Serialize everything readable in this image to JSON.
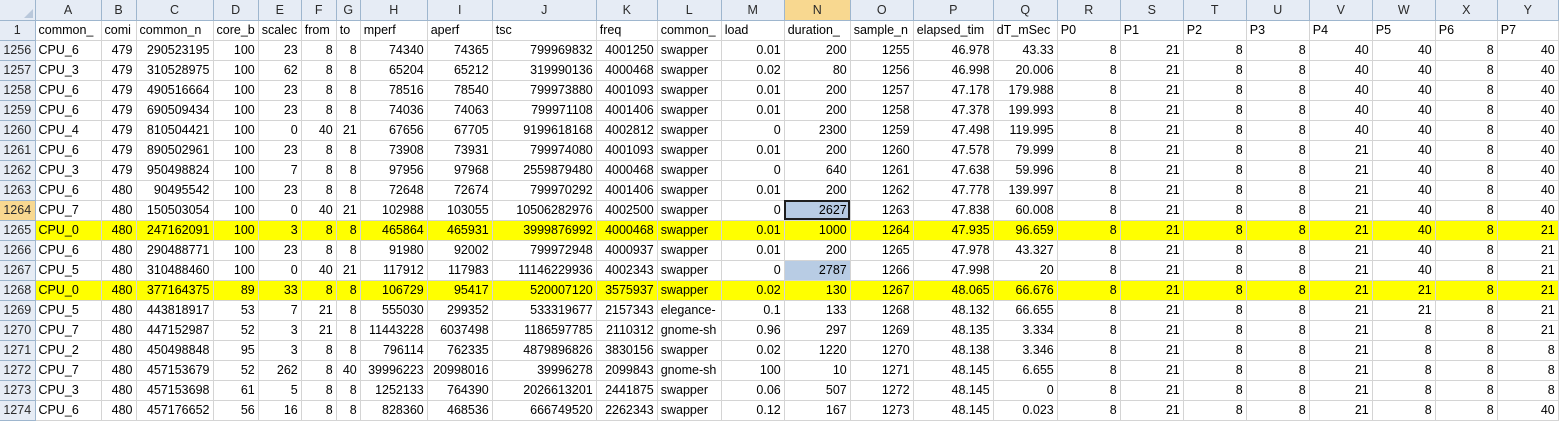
{
  "columns": [
    "A",
    "B",
    "C",
    "D",
    "E",
    "F",
    "G",
    "H",
    "I",
    "J",
    "K",
    "L",
    "M",
    "N",
    "O",
    "P",
    "Q",
    "R",
    "S",
    "T",
    "U",
    "V",
    "W",
    "X",
    "Y"
  ],
  "header_row": {
    "number": "1",
    "cells": [
      "common_",
      "comi",
      "common_n",
      "core_b",
      "scalec",
      "from",
      "to",
      "mperf",
      "aperf",
      "tsc",
      "freq",
      "common_",
      "load",
      "duration_",
      "sample_n",
      "elapsed_tim",
      "dT_mSec",
      "P0",
      "P1",
      "P2",
      "P3",
      "P4",
      "P5",
      "P6",
      "P7"
    ]
  },
  "rows": [
    {
      "n": "1256",
      "c": [
        "CPU_6",
        "479",
        "290523195",
        "100",
        "23",
        "8",
        "8",
        "74340",
        "74365",
        "799969832",
        "4001250",
        "swapper",
        "0.01",
        "200",
        "1255",
        "46.978",
        "43.33",
        "8",
        "21",
        "8",
        "8",
        "40",
        "40",
        "8",
        "40"
      ]
    },
    {
      "n": "1257",
      "c": [
        "CPU_3",
        "479",
        "310528975",
        "100",
        "62",
        "8",
        "8",
        "65204",
        "65212",
        "319990136",
        "4000468",
        "swapper",
        "0.02",
        "80",
        "1256",
        "46.998",
        "20.006",
        "8",
        "21",
        "8",
        "8",
        "40",
        "40",
        "8",
        "40"
      ]
    },
    {
      "n": "1258",
      "c": [
        "CPU_6",
        "479",
        "490516664",
        "100",
        "23",
        "8",
        "8",
        "78516",
        "78540",
        "799973880",
        "4001093",
        "swapper",
        "0.01",
        "200",
        "1257",
        "47.178",
        "179.988",
        "8",
        "21",
        "8",
        "8",
        "40",
        "40",
        "8",
        "40"
      ]
    },
    {
      "n": "1259",
      "c": [
        "CPU_6",
        "479",
        "690509434",
        "100",
        "23",
        "8",
        "8",
        "74036",
        "74063",
        "799971108",
        "4001406",
        "swapper",
        "0.01",
        "200",
        "1258",
        "47.378",
        "199.993",
        "8",
        "21",
        "8",
        "8",
        "40",
        "40",
        "8",
        "40"
      ]
    },
    {
      "n": "1260",
      "c": [
        "CPU_4",
        "479",
        "810504421",
        "100",
        "0",
        "40",
        "21",
        "67656",
        "67705",
        "9199618168",
        "4002812",
        "swapper",
        "0",
        "2300",
        "1259",
        "47.498",
        "119.995",
        "8",
        "21",
        "8",
        "8",
        "40",
        "40",
        "8",
        "40"
      ]
    },
    {
      "n": "1261",
      "c": [
        "CPU_6",
        "479",
        "890502961",
        "100",
        "23",
        "8",
        "8",
        "73908",
        "73931",
        "799974080",
        "4001093",
        "swapper",
        "0.01",
        "200",
        "1260",
        "47.578",
        "79.999",
        "8",
        "21",
        "8",
        "8",
        "21",
        "40",
        "8",
        "40"
      ]
    },
    {
      "n": "1262",
      "c": [
        "CPU_3",
        "479",
        "950498824",
        "100",
        "7",
        "8",
        "8",
        "97956",
        "97968",
        "2559879480",
        "4000468",
        "swapper",
        "0",
        "640",
        "1261",
        "47.638",
        "59.996",
        "8",
        "21",
        "8",
        "8",
        "21",
        "40",
        "8",
        "40"
      ]
    },
    {
      "n": "1263",
      "c": [
        "CPU_6",
        "480",
        "90495542",
        "100",
        "23",
        "8",
        "8",
        "72648",
        "72674",
        "799970292",
        "4001406",
        "swapper",
        "0.01",
        "200",
        "1262",
        "47.778",
        "139.997",
        "8",
        "21",
        "8",
        "8",
        "21",
        "40",
        "8",
        "40"
      ]
    },
    {
      "n": "1264",
      "c": [
        "CPU_7",
        "480",
        "150503054",
        "100",
        "0",
        "40",
        "21",
        "102988",
        "103055",
        "10506282976",
        "4002500",
        "swapper",
        "0",
        "2627",
        "1263",
        "47.838",
        "60.008",
        "8",
        "21",
        "8",
        "8",
        "21",
        "40",
        "8",
        "40"
      ]
    },
    {
      "n": "1265",
      "c": [
        "CPU_0",
        "480",
        "247162091",
        "100",
        "3",
        "8",
        "8",
        "465864",
        "465931",
        "3999876992",
        "4000468",
        "swapper",
        "0.01",
        "1000",
        "1264",
        "47.935",
        "96.659",
        "8",
        "21",
        "8",
        "8",
        "21",
        "40",
        "8",
        "21"
      ]
    },
    {
      "n": "1266",
      "c": [
        "CPU_6",
        "480",
        "290488771",
        "100",
        "23",
        "8",
        "8",
        "91980",
        "92002",
        "799972948",
        "4000937",
        "swapper",
        "0.01",
        "200",
        "1265",
        "47.978",
        "43.327",
        "8",
        "21",
        "8",
        "8",
        "21",
        "40",
        "8",
        "21"
      ]
    },
    {
      "n": "1267",
      "c": [
        "CPU_5",
        "480",
        "310488460",
        "100",
        "0",
        "40",
        "21",
        "117912",
        "117983",
        "11146229936",
        "4002343",
        "swapper",
        "0",
        "2787",
        "1266",
        "47.998",
        "20",
        "8",
        "21",
        "8",
        "8",
        "21",
        "40",
        "8",
        "21"
      ]
    },
    {
      "n": "1268",
      "c": [
        "CPU_0",
        "480",
        "377164375",
        "89",
        "33",
        "8",
        "8",
        "106729",
        "95417",
        "520007120",
        "3575937",
        "swapper",
        "0.02",
        "130",
        "1267",
        "48.065",
        "66.676",
        "8",
        "21",
        "8",
        "8",
        "21",
        "21",
        "8",
        "21"
      ]
    },
    {
      "n": "1269",
      "c": [
        "CPU_5",
        "480",
        "443818917",
        "53",
        "7",
        "21",
        "8",
        "555030",
        "299352",
        "533319677",
        "2157343",
        "elegance-",
        "0.1",
        "133",
        "1268",
        "48.132",
        "66.655",
        "8",
        "21",
        "8",
        "8",
        "21",
        "21",
        "8",
        "21"
      ]
    },
    {
      "n": "1270",
      "c": [
        "CPU_7",
        "480",
        "447152987",
        "52",
        "3",
        "21",
        "8",
        "11443228",
        "6037498",
        "1186597785",
        "2110312",
        "gnome-sh",
        "0.96",
        "297",
        "1269",
        "48.135",
        "3.334",
        "8",
        "21",
        "8",
        "8",
        "21",
        "8",
        "8",
        "21"
      ]
    },
    {
      "n": "1271",
      "c": [
        "CPU_2",
        "480",
        "450498848",
        "95",
        "3",
        "8",
        "8",
        "796114",
        "762335",
        "4879896826",
        "3830156",
        "swapper",
        "0.02",
        "1220",
        "1270",
        "48.138",
        "3.346",
        "8",
        "21",
        "8",
        "8",
        "21",
        "8",
        "8",
        "8"
      ]
    },
    {
      "n": "1272",
      "c": [
        "CPU_7",
        "480",
        "457153679",
        "52",
        "262",
        "8",
        "40",
        "39996223",
        "20998016",
        "39996278",
        "2099843",
        "gnome-sh",
        "100",
        "10",
        "1271",
        "48.145",
        "6.655",
        "8",
        "21",
        "8",
        "8",
        "21",
        "8",
        "8",
        "8"
      ]
    },
    {
      "n": "1273",
      "c": [
        "CPU_3",
        "480",
        "457153698",
        "61",
        "5",
        "8",
        "8",
        "1252133",
        "764390",
        "2026613201",
        "2441875",
        "swapper",
        "0.06",
        "507",
        "1272",
        "48.145",
        "0",
        "8",
        "21",
        "8",
        "8",
        "21",
        "8",
        "8",
        "8"
      ]
    },
    {
      "n": "1274",
      "c": [
        "CPU_6",
        "480",
        "457176652",
        "56",
        "16",
        "8",
        "8",
        "828360",
        "468536",
        "666749520",
        "2262343",
        "swapper",
        "0.12",
        "167",
        "1273",
        "48.145",
        "0.023",
        "8",
        "21",
        "8",
        "8",
        "21",
        "8",
        "8",
        "40"
      ]
    }
  ],
  "highlight_rows": [
    "1265",
    "1268"
  ],
  "blue_cells": [
    [
      "1264",
      "N"
    ],
    [
      "1267",
      "N"
    ]
  ],
  "active_cell": [
    "1264",
    "N"
  ],
  "selected_column": "N",
  "selected_row": "1264",
  "colors": {
    "highlight": "#ffff00",
    "selection_fill": "#b8cce4",
    "header_bg": "#e6ecf5",
    "header_selected": "#f8d890",
    "grid": "#d4d4d4"
  }
}
